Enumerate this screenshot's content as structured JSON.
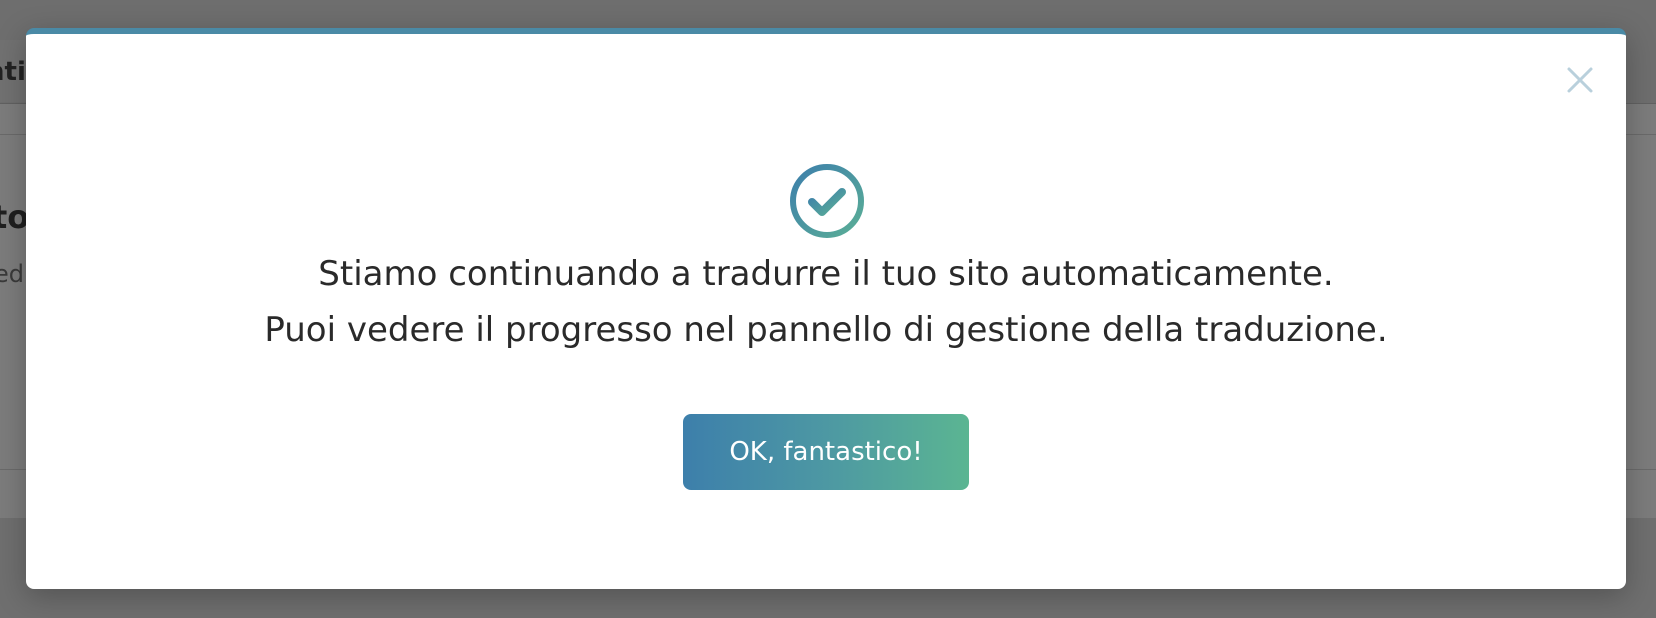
{
  "background": {
    "tab_fragment": "nti",
    "heading_fragment": "to",
    "subtext_fragment": "ed"
  },
  "modal": {
    "accent_color": "#4a8aa6",
    "message_line1": "Stiamo continuando a tradurre il tuo sito automaticamente.",
    "message_line2": "Puoi vedere il progresso nel pannello di gestione della traduzione.",
    "ok_button_label": "OK, fantastico!",
    "icons": {
      "success": "check-circle-icon",
      "close": "close-icon"
    }
  }
}
